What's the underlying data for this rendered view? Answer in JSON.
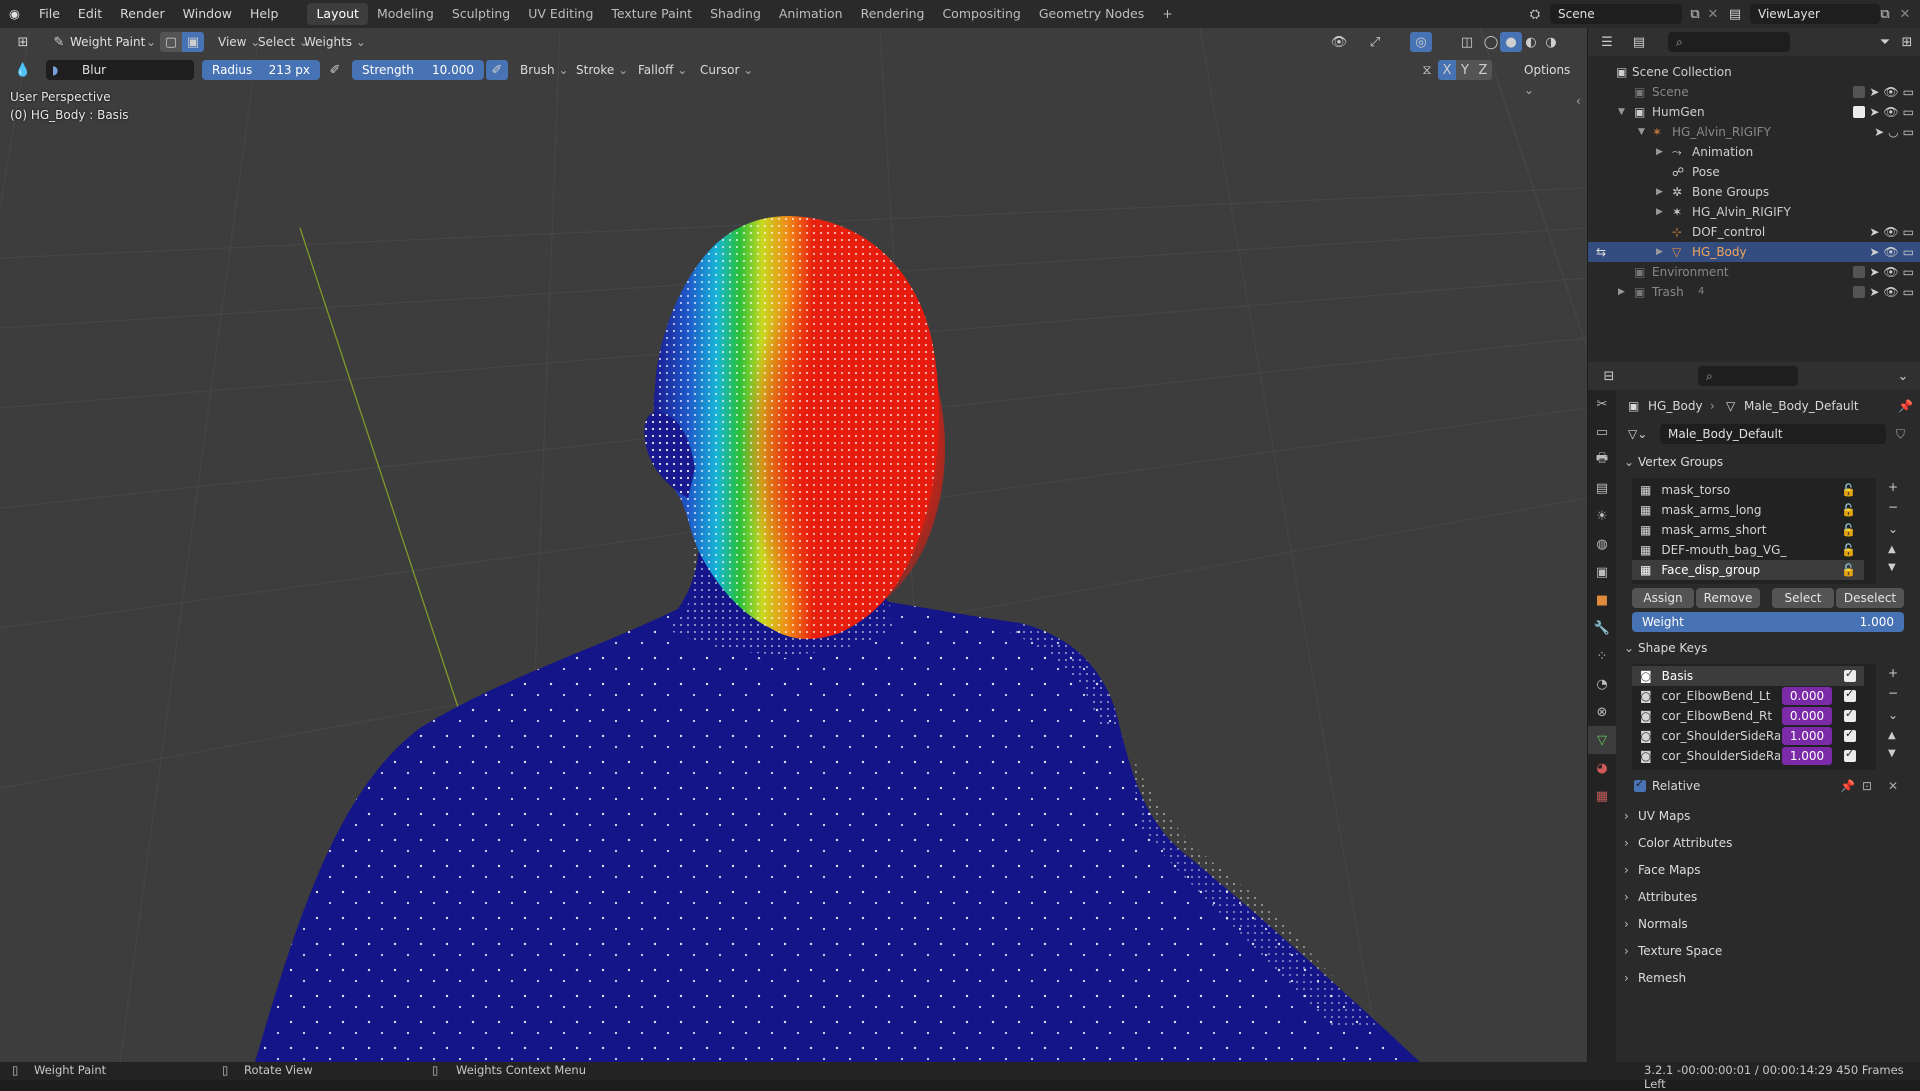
{
  "menu": [
    "File",
    "Edit",
    "Render",
    "Window",
    "Help"
  ],
  "workspaces": [
    "Layout",
    "Modeling",
    "Sculpting",
    "UV Editing",
    "Texture Paint",
    "Shading",
    "Animation",
    "Rendering",
    "Compositing",
    "Geometry Nodes"
  ],
  "workspace_add": "+",
  "scene": "Scene",
  "view_layer": "ViewLayer",
  "viewport_header": {
    "mode": "Weight Paint",
    "menus": [
      "View",
      "Select",
      "Weights"
    ],
    "brush_name": "Blur",
    "radius_label": "Radius",
    "radius_value": "213 px",
    "strength_label": "Strength",
    "strength_value": "10.000",
    "dropdowns": [
      "Brush",
      "Stroke",
      "Falloff",
      "Cursor"
    ],
    "axes": [
      "X",
      "Y",
      "Z"
    ],
    "options": "Options"
  },
  "viewport_info": {
    "perspective": "User Perspective",
    "object": "(0) HG_Body : Basis"
  },
  "outliner": {
    "rows": [
      {
        "label": "Scene Collection"
      },
      {
        "label": "Scene"
      },
      {
        "label": "HumGen"
      },
      {
        "label": "HG_Alvin_RIGIFY"
      },
      {
        "label": "Animation"
      },
      {
        "label": "Pose"
      },
      {
        "label": "Bone Groups"
      },
      {
        "label": "HG_Alvin_RIGIFY"
      },
      {
        "label": "DOF_control"
      },
      {
        "label": "HG_Body"
      },
      {
        "label": "Environment"
      },
      {
        "label": "Trash"
      }
    ],
    "trash_count": "4"
  },
  "properties": {
    "breadcrumb_object": "HG_Body",
    "breadcrumb_mesh": "Male_Body_Default",
    "mesh_name": "Male_Body_Default",
    "vertex_groups_title": "Vertex Groups",
    "vertex_groups": [
      "mask_torso",
      "mask_arms_long",
      "mask_arms_short",
      "DEF-mouth_bag_VG_",
      "Face_disp_group"
    ],
    "buttons": [
      "Assign",
      "Remove",
      "Select",
      "Deselect"
    ],
    "weight_label": "Weight",
    "weight_value": "1.000",
    "shape_keys_title": "Shape Keys",
    "shape_keys": [
      {
        "name": "Basis",
        "value": ""
      },
      {
        "name": "cor_ElbowBend_Lt",
        "value": "0.000"
      },
      {
        "name": "cor_ElbowBend_Rt",
        "value": "0.000"
      },
      {
        "name": "cor_ShoulderSideRa...",
        "value": "1.000"
      },
      {
        "name": "cor_ShoulderSideRa...",
        "value": "1.000"
      }
    ],
    "relative_label": "Relative",
    "collapsed_panels": [
      "UV Maps",
      "Color Attributes",
      "Face Maps",
      "Attributes",
      "Normals",
      "Texture Space",
      "Remesh"
    ]
  },
  "statusbar": {
    "left": "Weight Paint",
    "middle": "Rotate View",
    "right": "Weights Context Menu",
    "info": "3.2.1  -00:00:00:01 / 00:00:14:29  450 Frames Left"
  },
  "colors": {
    "accent_blue": "#4772b3",
    "selection": "#334d80",
    "shape_value": "#7b2aa8",
    "weight_zero": "#17178f",
    "weight_full": "#e81c0e"
  }
}
